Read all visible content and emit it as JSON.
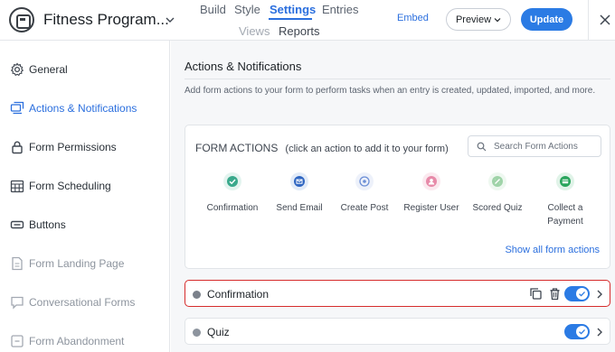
{
  "header": {
    "app_title": "Fitness Program...",
    "tabs_top": [
      "Build",
      "Style",
      "Settings",
      "Entries"
    ],
    "tabs_bottom": [
      "Views",
      "Reports"
    ],
    "embed_label": "Embed",
    "preview_label": "Preview",
    "update_label": "Update"
  },
  "sidebar": {
    "items": [
      {
        "label": "General",
        "icon": "gear-icon",
        "state": "normal"
      },
      {
        "label": "Actions & Notifications",
        "icon": "actions-icon",
        "state": "active"
      },
      {
        "label": "Form Permissions",
        "icon": "lock-icon",
        "state": "normal"
      },
      {
        "label": "Form Scheduling",
        "icon": "calendar-icon",
        "state": "normal"
      },
      {
        "label": "Buttons",
        "icon": "button-icon",
        "state": "normal"
      },
      {
        "label": "Form Landing Page",
        "icon": "document-icon",
        "state": "disabled"
      },
      {
        "label": "Conversational Forms",
        "icon": "chat-icon",
        "state": "disabled"
      },
      {
        "label": "Form Abandonment",
        "icon": "abandon-icon",
        "state": "disabled"
      }
    ]
  },
  "main": {
    "title": "Actions & Notifications",
    "description": "Add form actions to your form to perform tasks when an entry is created, updated, imported, and more.",
    "form_actions": {
      "heading_strong": "FORM ACTIONS",
      "heading_hint": "(click an action to add it to your form)",
      "search_placeholder": "Search Form Actions",
      "items": [
        {
          "label": "Confirmation",
          "icon": "check-icon",
          "color": "#3aa98c",
          "bg": "#e3f4ef"
        },
        {
          "label": "Send Email",
          "icon": "email-icon",
          "color": "#2f66c2",
          "bg": "#e2ebf8"
        },
        {
          "label": "Create Post",
          "icon": "post-icon",
          "color": "#6c8fd6",
          "bg": "#edf1fa"
        },
        {
          "label": "Register User",
          "icon": "user-icon",
          "color": "#e78aa9",
          "bg": "#fbe9ef"
        },
        {
          "label": "Scored Quiz",
          "icon": "quiz-icon",
          "color": "#9fd3a8",
          "bg": "#eef8f0"
        },
        {
          "label": "Collect a Payment",
          "icon": "payment-icon",
          "color": "#29a55c",
          "bg": "#e0f3e8"
        }
      ],
      "show_all_label": "Show all form actions"
    },
    "action_rows": [
      {
        "label": "Confirmation",
        "highlighted": true,
        "enabled": true
      },
      {
        "label": "Quiz",
        "highlighted": false,
        "enabled": true
      }
    ]
  },
  "colors": {
    "accent": "#2b6fde",
    "update_button": "#2b7be4",
    "highlight_border": "#d62c2c"
  }
}
